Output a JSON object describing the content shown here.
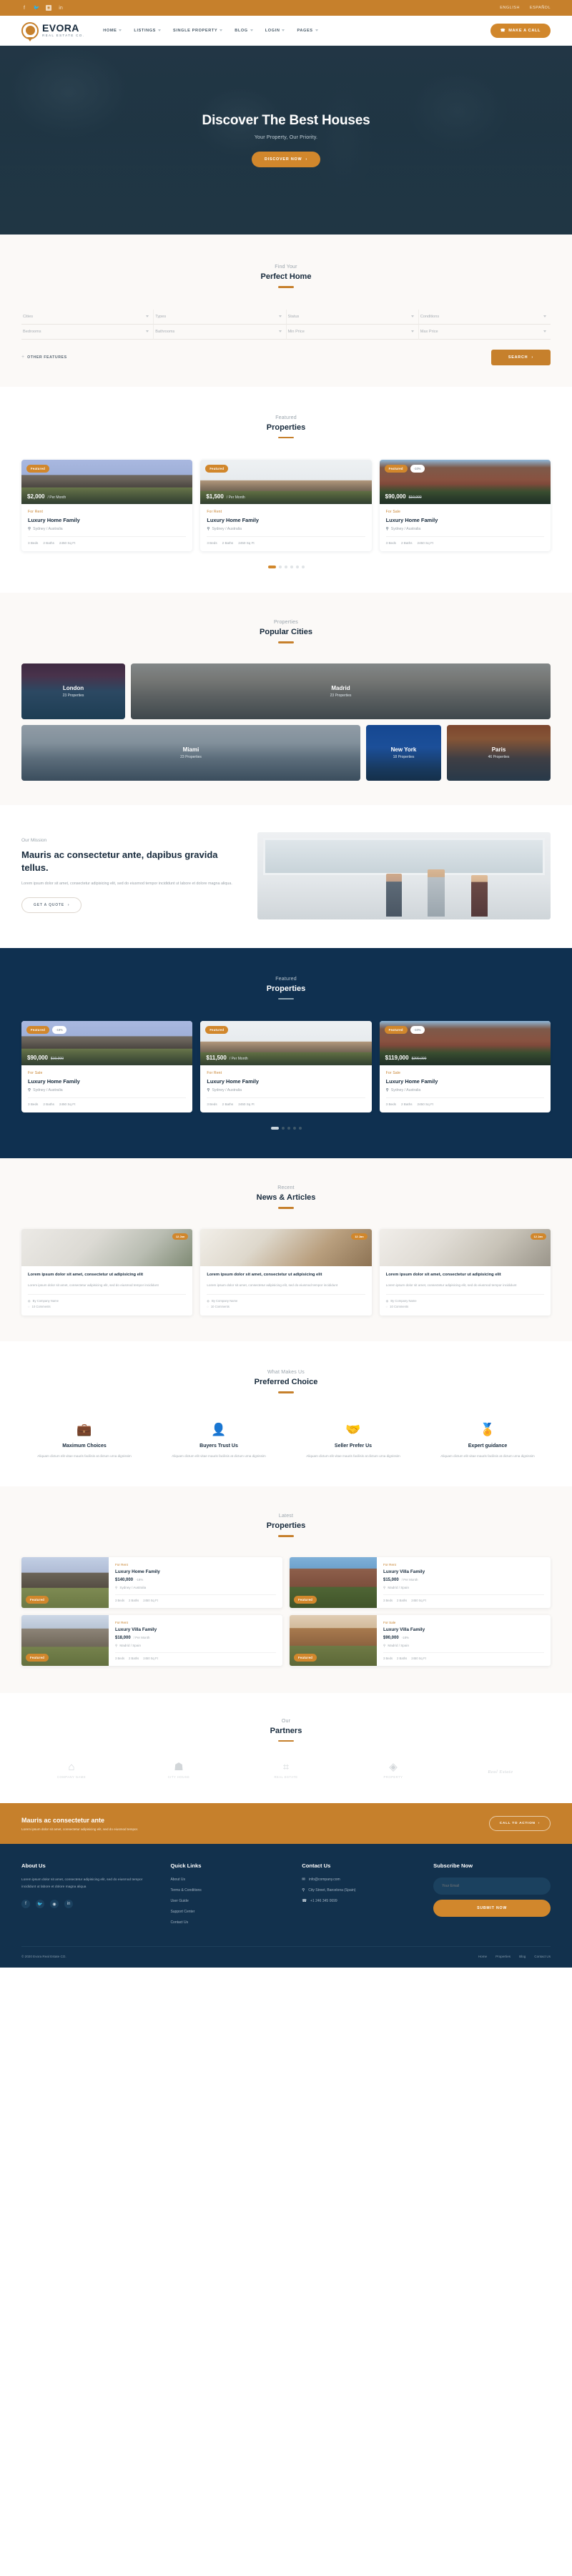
{
  "colors": {
    "accent": "#c6802c",
    "accent_btn": "#d1872c",
    "dark": "#0f3050",
    "footer": "#12314d"
  },
  "topbar": {
    "social": [
      "facebook-icon",
      "twitter-icon",
      "instagram-icon",
      "linkedin-icon"
    ],
    "languages": [
      "ENGLISH",
      "ESPAÑOL"
    ]
  },
  "brand": {
    "name": "EVORA",
    "tagline": "REAL ESTATE CO."
  },
  "nav": {
    "items": [
      {
        "label": "HOME"
      },
      {
        "label": "LISTINGS"
      },
      {
        "label": "SINGLE PROPERTY"
      },
      {
        "label": "BLOG"
      },
      {
        "label": "LOGIN"
      },
      {
        "label": "PAGES"
      }
    ],
    "call_button": "MAKE A CALL",
    "call_icon": "phone-icon"
  },
  "hero": {
    "title": "Discover The Best Houses",
    "subtitle": "Your Property, Our Priority.",
    "button": "DISCOVER NOW"
  },
  "search": {
    "kicker": "Find Your",
    "title": "Perfect Home",
    "row1": [
      "Cities",
      "Types",
      "Status",
      "Conditions"
    ],
    "row2": [
      "Bedrooms",
      "Bathrooms",
      "Min Price",
      "Max Price"
    ],
    "other_features": "OTHER FEATURES",
    "button": "SEARCH"
  },
  "featured": {
    "kicker": "Featured",
    "title": "Properties",
    "cards": [
      {
        "badge": "Featured",
        "discount": "",
        "price": "$2,000",
        "per": "/ Per Month",
        "old": "",
        "tag": "For Rent",
        "title": "Luxury Home Family",
        "location": "Sydney / Australia",
        "beds": "3 Beds",
        "baths": "2 Baths",
        "area": "2450 Sq Ft",
        "art": "h-a"
      },
      {
        "badge": "Featured",
        "discount": "",
        "price": "$1,500",
        "per": "/ Per Month",
        "old": "",
        "tag": "For Rent",
        "title": "Luxury Home Family",
        "location": "Sydney / Australia",
        "beds": "3 Beds",
        "baths": "2 Baths",
        "area": "2450 Sq Ft",
        "art": "h-b"
      },
      {
        "badge": "Featured",
        "discount": "-10%",
        "price": "$90,000",
        "per": "",
        "old": "$10,000",
        "tag": "For Sale",
        "title": "Luxury Home Family",
        "location": "Sydney / Australia",
        "beds": "3 Beds",
        "baths": "2 Baths",
        "area": "2450 Sq Ft",
        "art": "h-c"
      }
    ],
    "dots": 6,
    "active_dot": 0
  },
  "cities": {
    "kicker": "Properties",
    "title": "Popular Cities",
    "items": [
      {
        "name": "London",
        "count": "23 Properties",
        "cls": "city-london"
      },
      {
        "name": "Madrid",
        "count": "23 Properties",
        "cls": "city-madrid"
      },
      {
        "name": "Miami",
        "count": "23 Properties",
        "cls": "city-miami"
      },
      {
        "name": "New York",
        "count": "18 Properties",
        "cls": "city-ny"
      },
      {
        "name": "Paris",
        "count": "46 Properties",
        "cls": "city-paris"
      }
    ]
  },
  "mission": {
    "kicker": "Our Mission",
    "title": "Mauris ac consectetur ante, dapibus gravida tellus.",
    "text": "Lorem ipsum dolor sit amet, consectetur adipisicing elit, sed do eiusmod tempor incididunt ut labore et dolore magna aliqua.",
    "button": "GET A QUOTE"
  },
  "featured_dark": {
    "kicker": "Featured",
    "title": "Properties",
    "cards": [
      {
        "badge": "Featured",
        "discount": "-18%",
        "price": "$90,000",
        "per": "",
        "old": "$10,000",
        "tag": "For Sale",
        "title": "Luxury Home Family",
        "location": "Sydney / Australia",
        "beds": "3 Beds",
        "baths": "2 Baths",
        "area": "2450 Sq Ft",
        "art": "h-a"
      },
      {
        "badge": "Featured",
        "discount": "",
        "price": "$11,500",
        "per": "/ Per Month",
        "old": "",
        "tag": "For Rent",
        "title": "Luxury Home Family",
        "location": "Sydney / Australia",
        "beds": "3 Beds",
        "baths": "2 Baths",
        "area": "2450 Sq Ft",
        "art": "h-b"
      },
      {
        "badge": "Featured",
        "discount": "-10%",
        "price": "$119,000",
        "per": "",
        "old": "$200,000",
        "tag": "For Sale",
        "title": "Luxury Home Family",
        "location": "Sydney / Australia",
        "beds": "3 Beds",
        "baths": "2 Baths",
        "area": "2450 Sq Ft",
        "art": "h-c"
      }
    ],
    "dots": 5,
    "active_dot": 0
  },
  "news": {
    "kicker": "Recent",
    "title": "News & Articles",
    "cards": [
      {
        "date": "12 Jan",
        "title": "Lorem ipsum dolor sit amet, consectetur ut adipisicing elit",
        "excerpt": "Lorem ipsum dolor sit amet, consectetur adipisicing elit, sed do eiusmod tempor incididunt",
        "author": "By Company Name",
        "comments": "10 Comments",
        "art": "n-a"
      },
      {
        "date": "12 Jan",
        "title": "Lorem ipsum dolor sit amet, consectetur ut adipisicing elit",
        "excerpt": "Lorem ipsum dolor sit amet, consectetur adipisicing elit, sed do eiusmod tempor incididunt",
        "author": "By Company Name",
        "comments": "10 Comments",
        "art": "n-b"
      },
      {
        "date": "12 Jan",
        "title": "Lorem ipsum dolor sit amet, consectetur ut adipisicing elit",
        "excerpt": "Lorem ipsum dolor sit amet, consectetur adipisicing elit, sed do eiusmod tempor incididunt",
        "author": "By Company Name",
        "comments": "10 Comments",
        "art": "n-c"
      }
    ]
  },
  "features": {
    "kicker": "What Makes Us",
    "title": "Preferred Choice",
    "items": [
      {
        "icon": "briefcase-clock-icon",
        "glyph": "💼",
        "title": "Maximum Choices",
        "text": "Aliquam dictum elit vitae mauris facilisis at dictum urna dignissim"
      },
      {
        "icon": "user-shield-icon",
        "glyph": "👤",
        "title": "Buyers Trust Us",
        "text": "Aliquam dictum elit vitae mauris facilisis at dictum urna dignissim"
      },
      {
        "icon": "handshake-icon",
        "glyph": "🤝",
        "title": "Seller Prefer Us",
        "text": "Aliquam dictum elit vitae mauris facilisis at dictum urna dignissim"
      },
      {
        "icon": "medal-icon",
        "glyph": "🏅",
        "title": "Expert guidance",
        "text": "Aliquam dictum elit vitae mauris facilisis at dictum urna dignissim"
      }
    ]
  },
  "latest": {
    "kicker": "Latest",
    "title": "Properties",
    "cards": [
      {
        "badge": "Featured",
        "tag": "For Rent",
        "title": "Luxury Home Family",
        "price": "$140,000",
        "old": "-18%",
        "per": "",
        "location": "Sydney / Australia",
        "beds": "3 Beds",
        "baths": "2 Baths",
        "area": "2450 Sq Ft",
        "art": "l-a"
      },
      {
        "badge": "Featured",
        "tag": "For Rent",
        "title": "Luxury Villa Family",
        "price": "$15,000",
        "old": "/ Per Month",
        "per": "",
        "location": "Madrid / Spain",
        "beds": "3 Beds",
        "baths": "2 Baths",
        "area": "2450 Sq Ft",
        "art": "l-b"
      },
      {
        "badge": "Featured",
        "tag": "For Rent",
        "title": "Luxury Villa Family",
        "price": "$18,000",
        "old": "/ Per Month",
        "per": "",
        "location": "Madrid / Spain",
        "beds": "3 Beds",
        "baths": "2 Baths",
        "area": "2450 Sq Ft",
        "art": "l-c"
      },
      {
        "badge": "Featured",
        "tag": "For Sale",
        "title": "Luxury Villa Family",
        "price": "$90,000",
        "old": "-18%",
        "per": "",
        "location": "Madrid / Spain",
        "beds": "3 Beds",
        "baths": "2 Baths",
        "area": "2450 Sq Ft",
        "art": "l-d"
      }
    ]
  },
  "partners": {
    "kicker": "Our",
    "title": "Partners",
    "items": [
      {
        "glyph": "⌂",
        "name": "COMPANY NAME"
      },
      {
        "glyph": "☗",
        "name": "CITY HOUSE"
      },
      {
        "glyph": "⌗",
        "name": "REAL ESTATE"
      },
      {
        "glyph": "◈",
        "name": "PROPERTY"
      },
      {
        "glyph": "",
        "name": "Real Estate"
      }
    ]
  },
  "cta": {
    "title": "Mauris ac consectetur ante",
    "text": "Lorem ipsum dolor sit amet, consectetur adipisicing elit, sed do eiusmod tempor.",
    "button": "CALL TO ACTION"
  },
  "footer": {
    "about": {
      "heading": "About Us",
      "text": "Lorem ipsum dolor sit amet, consectetur adipisicing elit, sed do eiusmod tempor incididunt ut labore et dolore magna aliqua",
      "social": [
        "facebook-icon",
        "twitter-icon",
        "instagram-icon",
        "linkedin-icon"
      ]
    },
    "quick": {
      "heading": "Quick Links",
      "links": [
        "About Us",
        "Terms & Conditions",
        "User Guide",
        "Support Center",
        "Contact Us"
      ]
    },
    "contact": {
      "heading": "Contact Us",
      "items": [
        {
          "icon": "envelope-icon",
          "glyph": "✉",
          "text": "info@company.com"
        },
        {
          "icon": "map-pin-icon",
          "glyph": "⚲",
          "text": "City Street, Barcelona (Spain)"
        },
        {
          "icon": "phone-icon",
          "glyph": "☎",
          "text": "+1 246 345 0699"
        }
      ]
    },
    "subscribe": {
      "heading": "Subscribe Now",
      "placeholder": "Your Email",
      "button": "SUBMIT NOW"
    },
    "copyright": "© 2020 Evora Real Estate CO.",
    "bottom_links": [
      "Home",
      "Properties",
      "Blog",
      "Contact Us"
    ]
  }
}
